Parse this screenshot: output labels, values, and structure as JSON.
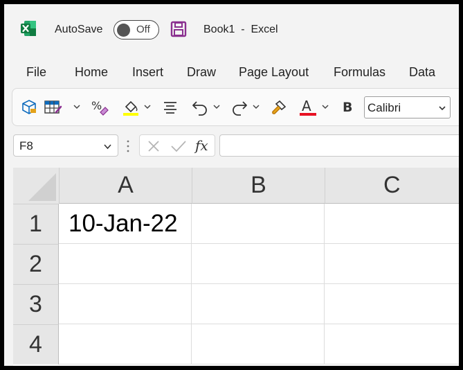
{
  "titlebar": {
    "autosave_label": "AutoSave",
    "autosave_state": "Off",
    "document_title": "Book1  -  Excel",
    "brand_color": "#107c41"
  },
  "menu": {
    "items": [
      "File",
      "Home",
      "Insert",
      "Draw",
      "Page Layout",
      "Formulas",
      "Data"
    ]
  },
  "ribbon": {
    "font_name": "Calibri",
    "bold_label": "B",
    "fill_color": "#ffff00",
    "font_color": "#e81123"
  },
  "formula_bar": {
    "name_box": "F8",
    "fx_label": "fx",
    "formula_value": ""
  },
  "grid": {
    "columns": [
      "A",
      "B",
      "C"
    ],
    "rows": [
      "1",
      "2",
      "3",
      "4"
    ],
    "cells": {
      "A1": "10-Jan-22"
    }
  }
}
